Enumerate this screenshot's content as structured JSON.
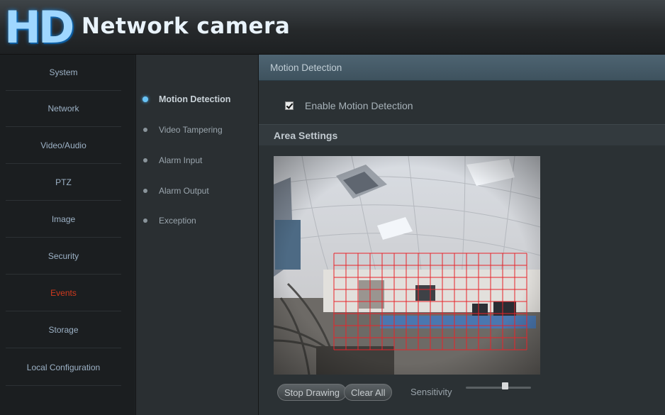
{
  "header": {
    "logo_text": "HD",
    "title": "Network camera"
  },
  "sidebar": {
    "items": [
      {
        "label": "System",
        "active": false
      },
      {
        "label": "Network",
        "active": false
      },
      {
        "label": "Video/Audio",
        "active": false
      },
      {
        "label": "PTZ",
        "active": false
      },
      {
        "label": "Image",
        "active": false
      },
      {
        "label": "Security",
        "active": false
      },
      {
        "label": "Events",
        "active": true
      },
      {
        "label": "Storage",
        "active": false
      },
      {
        "label": "Local Configuration",
        "active": false
      }
    ]
  },
  "subnav": {
    "items": [
      {
        "label": "Motion Detection",
        "active": true
      },
      {
        "label": "Video Tampering",
        "active": false
      },
      {
        "label": "Alarm Input",
        "active": false
      },
      {
        "label": "Alarm Output",
        "active": false
      },
      {
        "label": "Exception",
        "active": false
      }
    ]
  },
  "main": {
    "title": "Motion Detection",
    "enable_label": "Enable Motion Detection",
    "enable_checked": true,
    "area_settings_label": "Area Settings",
    "stop_drawing_label": "Stop Drawing",
    "clear_all_label": "Clear All",
    "sensitivity_label": "Sensitivity",
    "sensitivity_level": 0.6
  },
  "colors": {
    "active_nav": "#d23a1e",
    "grid_line": "#e8242a",
    "header_title": "#e9f3fb",
    "active_bullet": "#69c3f5"
  }
}
